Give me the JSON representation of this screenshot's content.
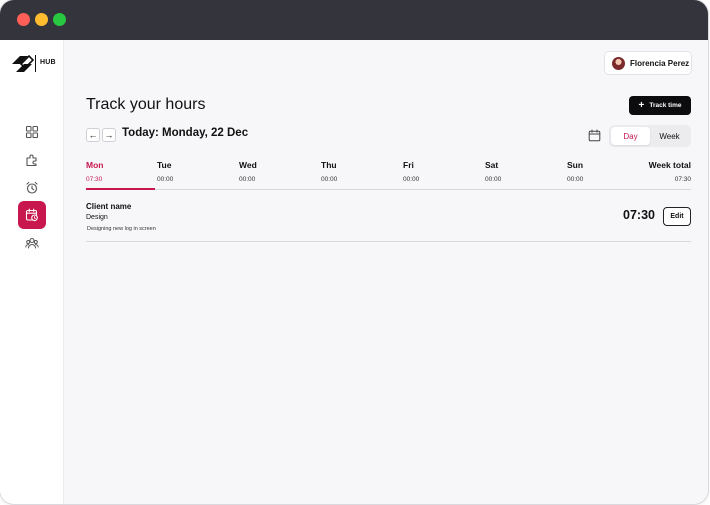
{
  "app": {
    "logo_text": "HUB"
  },
  "sidebar": {
    "items": [
      {
        "icon": "dashboard-icon",
        "active": false
      },
      {
        "icon": "puzzle-icon",
        "active": false
      },
      {
        "icon": "alarm-clock-icon",
        "active": false
      },
      {
        "icon": "calendar-clock-icon",
        "active": true
      },
      {
        "icon": "team-icon",
        "active": false
      }
    ]
  },
  "header": {
    "user_name": "Florencia Perez",
    "page_title": "Track your hours",
    "track_button_label": "Track time",
    "date_label": "Today: Monday, 22 Dec",
    "view_toggle": {
      "options": [
        "Day",
        "Week"
      ],
      "selected": "Day"
    }
  },
  "week": {
    "days": [
      {
        "name": "Mon",
        "time": "07:30",
        "active": true
      },
      {
        "name": "Tue",
        "time": "00:00",
        "active": false
      },
      {
        "name": "Wed",
        "time": "00:00",
        "active": false
      },
      {
        "name": "Thu",
        "time": "00:00",
        "active": false
      },
      {
        "name": "Fri",
        "time": "00:00",
        "active": false
      },
      {
        "name": "Sat",
        "time": "00:00",
        "active": false
      },
      {
        "name": "Sun",
        "time": "00:00",
        "active": false
      }
    ],
    "total": {
      "name": "Week total",
      "time": "07:30"
    }
  },
  "entries": [
    {
      "client": "Client name",
      "project": "Design",
      "description": "Designing new log in screen",
      "duration": "07:30",
      "edit_label": "Edit"
    }
  ],
  "colors": {
    "accent": "#c8174f",
    "titlebar": "#34343c",
    "primary_button": "#0c0c0e"
  }
}
